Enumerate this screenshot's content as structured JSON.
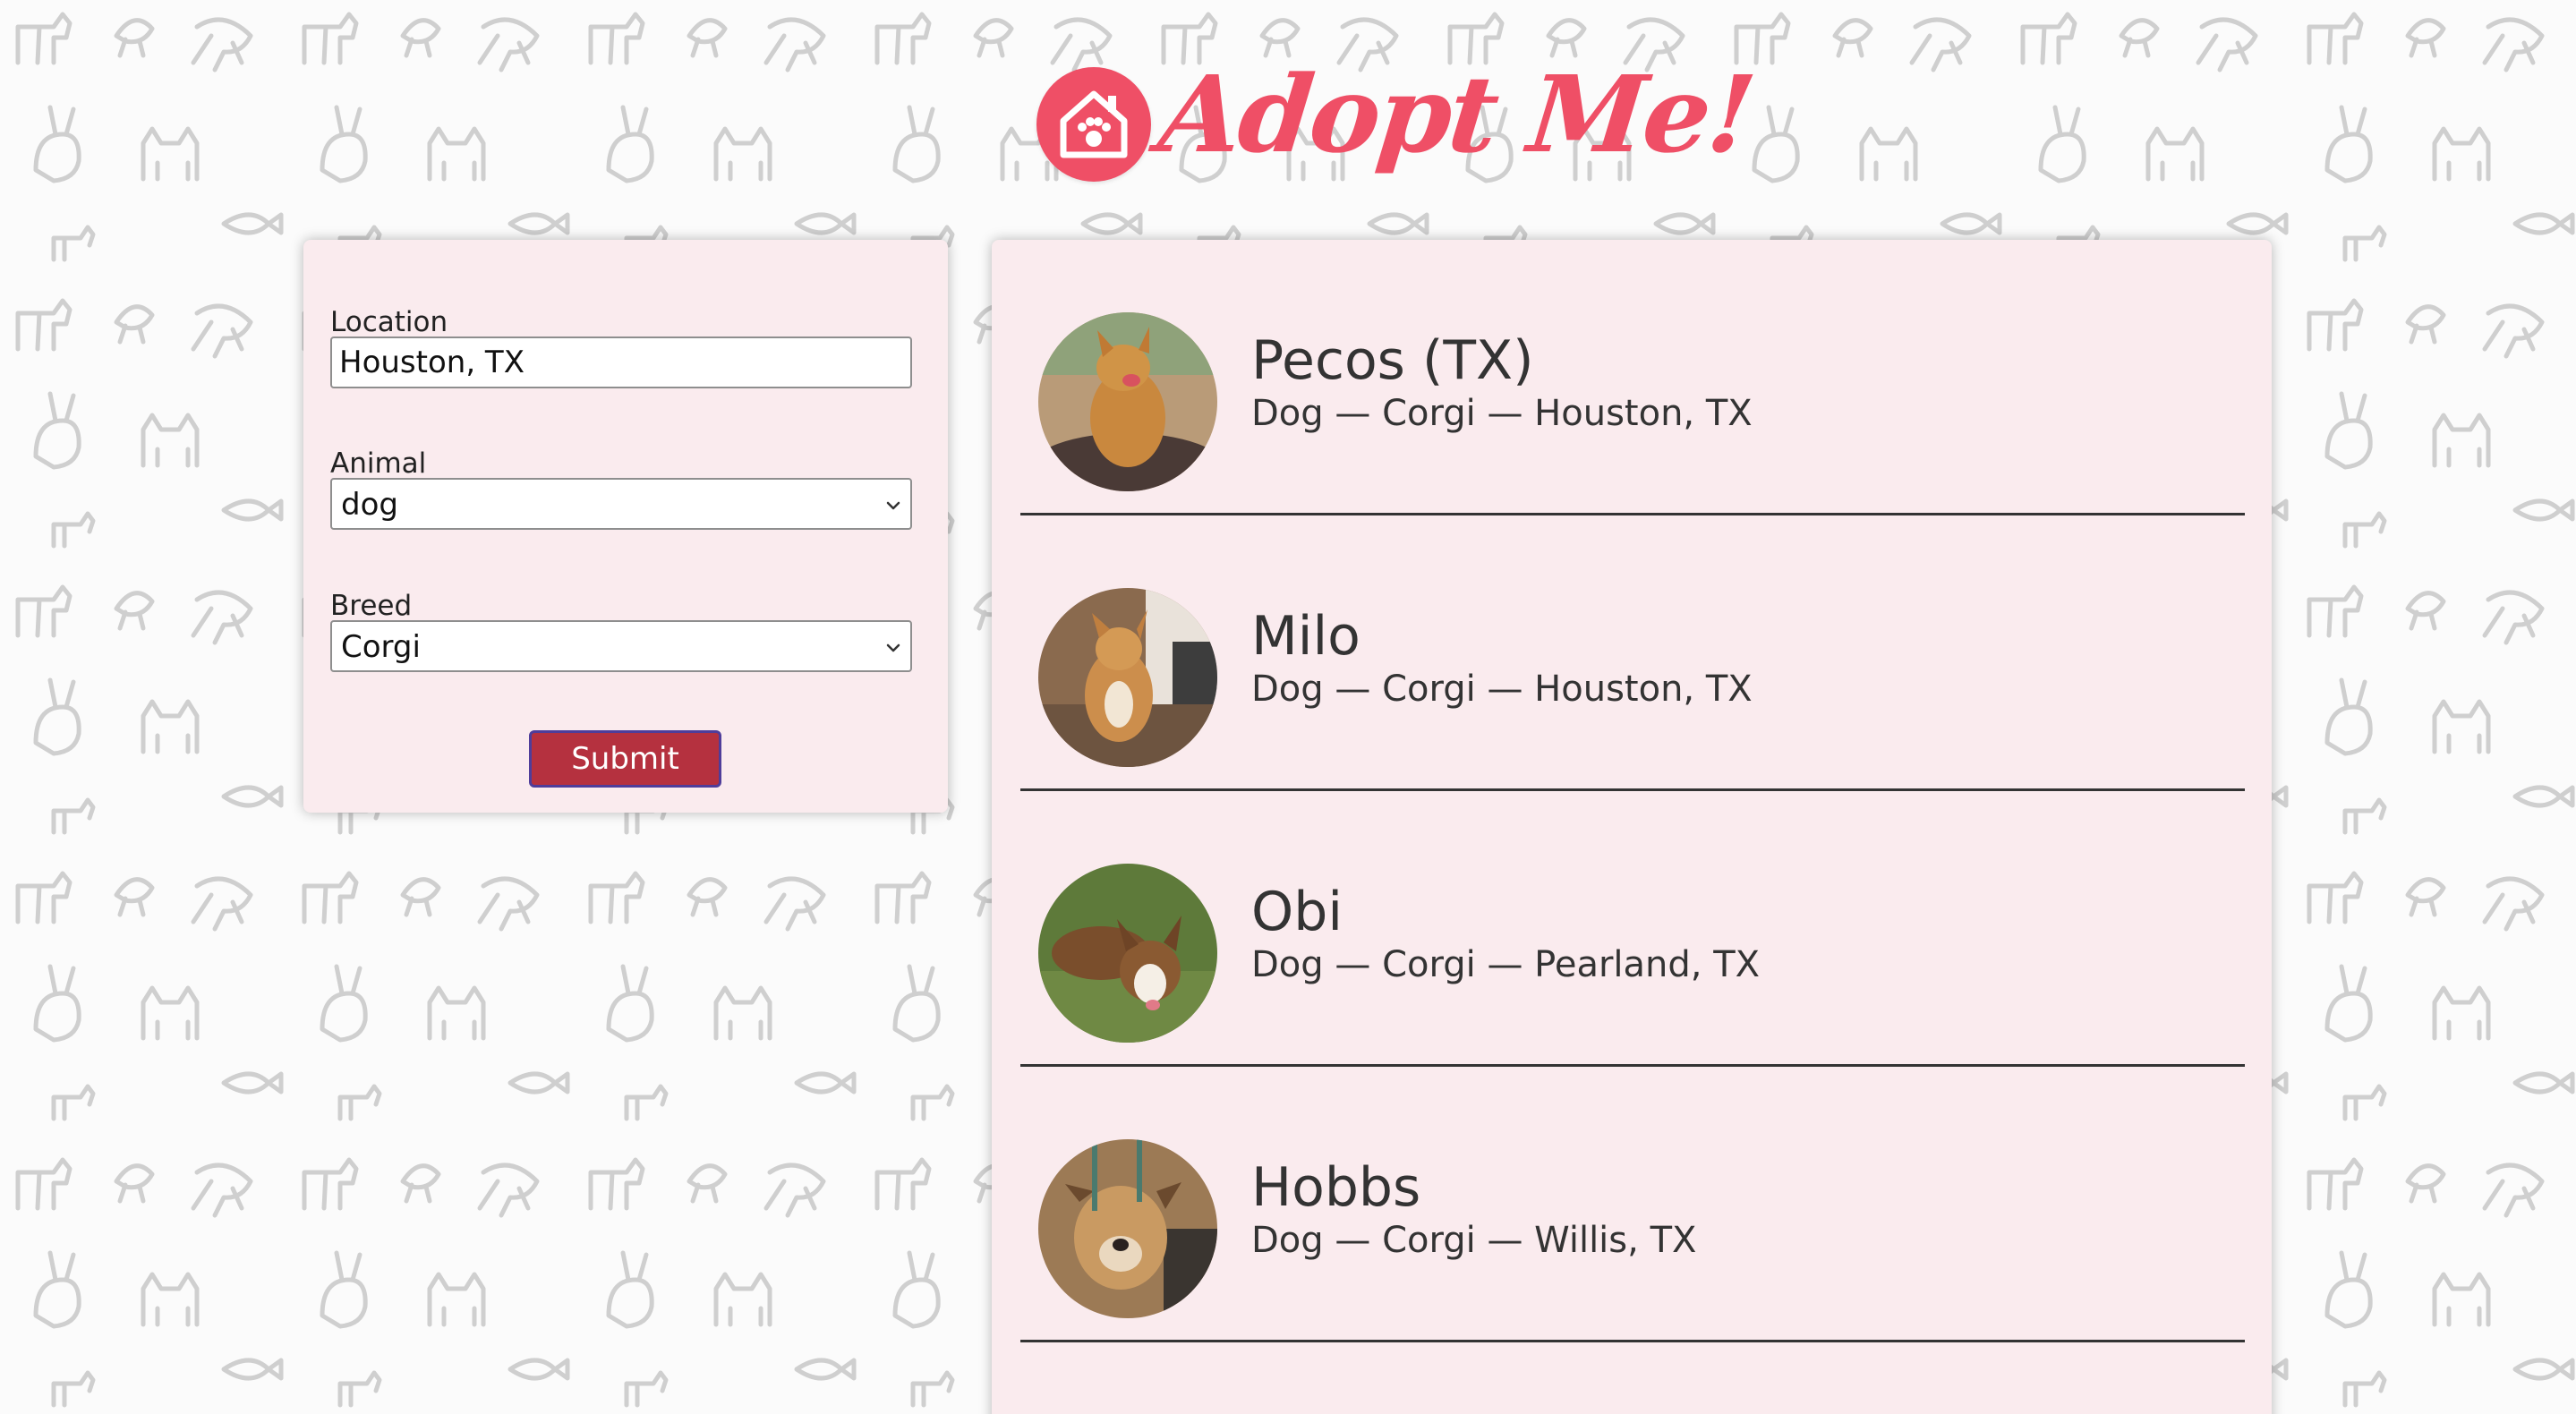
{
  "brand": {
    "title": "Adopt Me!",
    "logo_icon": "house-paw-icon",
    "color": "#ef4f66"
  },
  "search": {
    "location": {
      "label": "Location",
      "value": "Houston, TX"
    },
    "animal": {
      "label": "Animal",
      "value": "dog"
    },
    "breed": {
      "label": "Breed",
      "value": "Corgi"
    },
    "submit_label": "Submit"
  },
  "results": [
    {
      "name": "Pecos (TX)",
      "info": "Dog — Corgi — Houston, TX"
    },
    {
      "name": "Milo",
      "info": "Dog — Corgi — Houston, TX"
    },
    {
      "name": "Obi",
      "info": "Dog — Corgi — Pearland, TX"
    },
    {
      "name": "Hobbs",
      "info": "Dog — Corgi — Willis, TX"
    }
  ],
  "colors": {
    "panel_bg": "#faebee",
    "button_bg": "#b5313f",
    "button_border": "#4f3d9a"
  }
}
